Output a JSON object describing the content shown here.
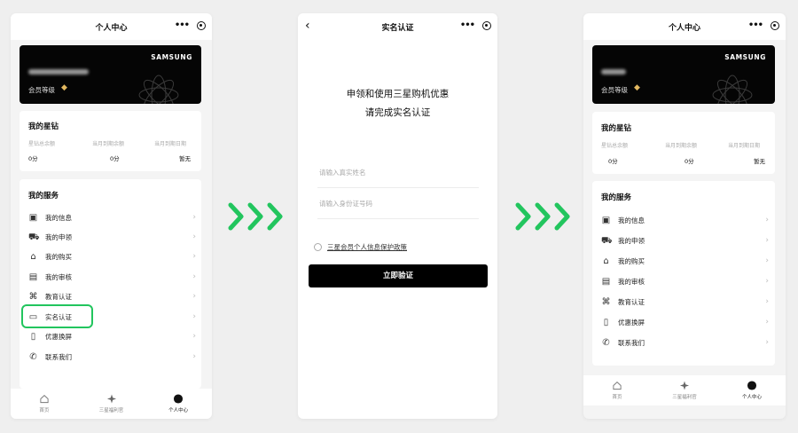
{
  "screens": [
    {
      "title": "个人中心",
      "card": {
        "brand": "SAMSUNG",
        "level_label": "会员等级"
      },
      "stars": {
        "title": "我的星钻",
        "stats": [
          {
            "label": "星钻总余额",
            "value": "0分"
          },
          {
            "label": "当月到期余额",
            "value": "0分"
          },
          {
            "label": "当月到期日期",
            "value": "暂无"
          }
        ]
      },
      "services": {
        "title": "我的服务",
        "items": [
          {
            "label": "我的信息",
            "icon": "id-card-icon"
          },
          {
            "label": "我的申领",
            "icon": "car-icon"
          },
          {
            "label": "我的购买",
            "icon": "bag-icon"
          },
          {
            "label": "我的审核",
            "icon": "audit-doc-icon"
          },
          {
            "label": "教育认证",
            "icon": "graduation-cap-icon"
          },
          {
            "label": "实名认证",
            "icon": "name-card-icon"
          },
          {
            "label": "优惠换屏",
            "icon": "phone-screen-icon"
          },
          {
            "label": "联系我们",
            "icon": "phone-icon"
          }
        ]
      },
      "tabs": [
        {
          "label": "首页",
          "icon": "home-icon"
        },
        {
          "label": "三星福利官",
          "icon": "sparkle-icon"
        },
        {
          "label": "个人中心",
          "icon": "user-filled-icon"
        }
      ]
    },
    {
      "title": "实名认证",
      "heading_line1": "申领和使用三星购机优惠",
      "heading_line2": "请完成实名认证",
      "name_placeholder": "请输入真实姓名",
      "id_placeholder": "请输入身份证号码",
      "agreement": "三星会员个人信息保护政策",
      "submit": "立即验证"
    },
    {
      "title": "个人中心",
      "card": {
        "brand": "SAMSUNG",
        "level_label": "会员等级"
      },
      "stars": {
        "title": "我的星钻",
        "stats": [
          {
            "label": "星钻总余额",
            "value": "0分"
          },
          {
            "label": "当月到期余额",
            "value": "0分"
          },
          {
            "label": "当月到期日期",
            "value": "暂无"
          }
        ]
      },
      "services": {
        "title": "我的服务",
        "items": [
          {
            "label": "我的信息",
            "icon": "id-card-icon"
          },
          {
            "label": "我的申领",
            "icon": "car-icon"
          },
          {
            "label": "我的购买",
            "icon": "bag-icon"
          },
          {
            "label": "我的审核",
            "icon": "audit-doc-icon"
          },
          {
            "label": "教育认证",
            "icon": "graduation-cap-icon"
          },
          {
            "label": "优惠换屏",
            "icon": "phone-screen-icon"
          },
          {
            "label": "联系我们",
            "icon": "phone-icon"
          }
        ]
      },
      "tabs": [
        {
          "label": "首页",
          "icon": "home-icon"
        },
        {
          "label": "三星福利官",
          "icon": "sparkle-icon"
        },
        {
          "label": "个人中心",
          "icon": "user-filled-icon"
        }
      ]
    }
  ],
  "colors": {
    "accent": "#22c55e",
    "card_bg": "#050505",
    "cta_bg": "#000000",
    "diamond": "#e2b860"
  }
}
